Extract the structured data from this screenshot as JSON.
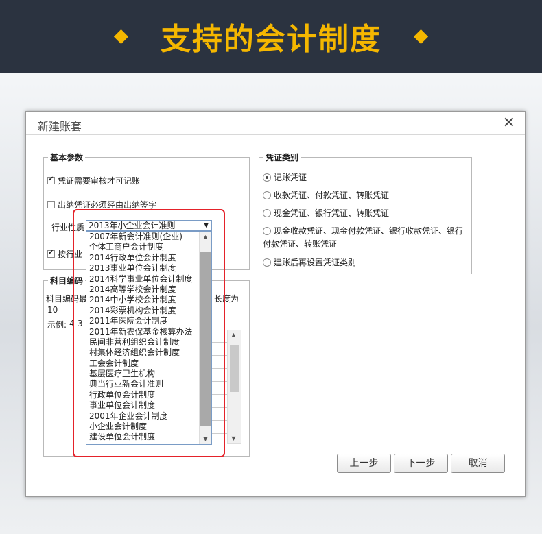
{
  "banner": {
    "title": "支持的会计制度"
  },
  "dialog": {
    "title": "新建账套",
    "basic": {
      "legend": "基本参数",
      "cb_audit": "凭证需要审核才可记账",
      "cb_cashier": "出纳凭证必须经由出纳签字",
      "industry_label": "行业性质",
      "industry_value": "2013年小企业会计准则",
      "cb_preset": "按行业"
    },
    "coding": {
      "legend": "科目编码",
      "line1_start": "科目编码最",
      "line1_end": "长度为",
      "line2": "10",
      "example_label": "示例:",
      "example_value": "4-3-"
    },
    "voucher": {
      "legend": "凭证类别",
      "options": [
        "记账凭证",
        "收款凭证、付款凭证、转账凭证",
        "现金凭证、银行凭证、转账凭证",
        "现金收款凭证、现金付款凭证、银行收款凭证、银行",
        "付款凭证、转账凭证",
        "建账后再设置凭证类别"
      ]
    },
    "dropdown_items": [
      "2007年新会计准则(企业)",
      "个体工商户会计制度",
      "2014行政单位会计制度",
      "2013事业单位会计制度",
      "2014科学事业单位会计制度",
      "2014高等学校会计制度",
      "2014中小学校会计制度",
      "2014彩票机构会计制度",
      "2011年医院会计制度",
      "2011年新农保基金核算办法",
      "民间非营利组织会计制度",
      "村集体经济组织会计制度",
      "工会会计制度",
      "基层医疗卫生机构",
      "典当行业新会计准则",
      "行政单位会计制度",
      "事业单位会计制度",
      "2001年企业会计制度",
      "小企业会计制度",
      "建设单位会计制度"
    ],
    "buttons": {
      "prev": "上一步",
      "next": "下一步",
      "cancel": "取消"
    }
  }
}
